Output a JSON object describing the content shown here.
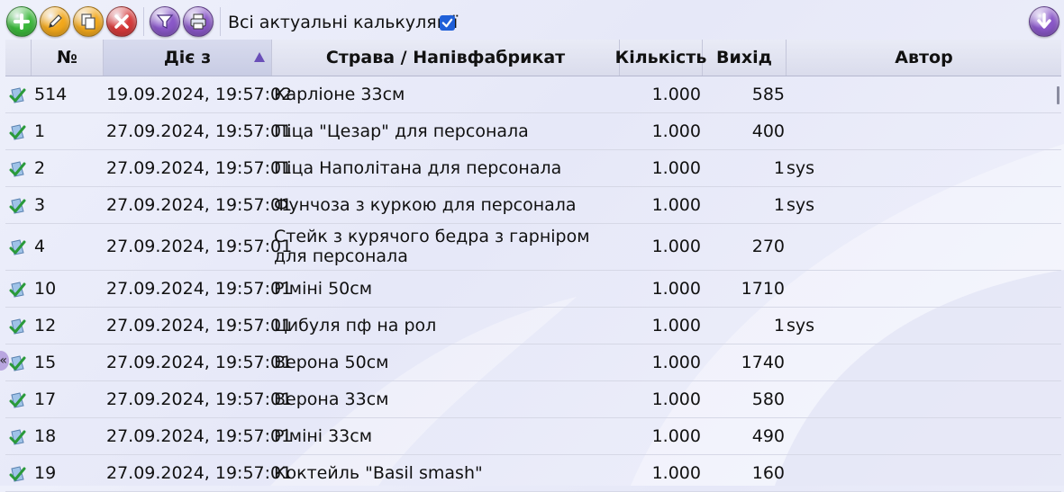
{
  "toolbar": {
    "buttons": [
      {
        "name": "add-button",
        "icon": "plus-icon",
        "color": "#3cb83c"
      },
      {
        "name": "edit-button",
        "icon": "pencil-icon",
        "color": "#f2a81c"
      },
      {
        "name": "copy-button",
        "icon": "copy-icon",
        "color": "#f2a81c"
      },
      {
        "name": "delete-button",
        "icon": "close-icon",
        "color": "#d63a3a"
      },
      {
        "name": "filter-button",
        "icon": "filter-icon",
        "color": "#8a58c8"
      },
      {
        "name": "print-button",
        "icon": "printer-icon",
        "color": "#8a58c8"
      },
      {
        "name": "scroll-down-button",
        "icon": "arrow-down-icon",
        "color": "#8a58c8"
      }
    ],
    "filter_label": "Всі актуальні калькуляції",
    "filter_checked": true
  },
  "table": {
    "columns": [
      "№",
      "Діє з",
      "Страва / Напівфабрикат",
      "Кількість",
      "Вихід",
      "Автор"
    ],
    "sorted_column": "Діє з",
    "sort_direction": "ascending",
    "rows": [
      {
        "no": "514",
        "date": "19.09.2024, 19:57:02",
        "name": "Карліоне 33см",
        "qty": "1.000",
        "out": "585",
        "unit": "",
        "author": ""
      },
      {
        "no": "1",
        "date": "27.09.2024, 19:57:01",
        "name": "Піца \"Цезар\" для персонала",
        "qty": "1.000",
        "out": "400",
        "unit": "",
        "author": ""
      },
      {
        "no": "2",
        "date": "27.09.2024, 19:57:01",
        "name": "Піца Наполітана для персонала",
        "qty": "1.000",
        "out": "1",
        "unit": "sys",
        "author": ""
      },
      {
        "no": "3",
        "date": "27.09.2024, 19:57:01",
        "name": "Фунчоза з куркою для персонала",
        "qty": "1.000",
        "out": "1",
        "unit": "sys",
        "author": ""
      },
      {
        "no": "4",
        "date": "27.09.2024, 19:57:01",
        "name": "Стейк з курячого бедра з гарніром для персонала",
        "qty": "1.000",
        "out": "270",
        "unit": "",
        "author": ""
      },
      {
        "no": "10",
        "date": "27.09.2024, 19:57:01",
        "name": "Ріміні 50см",
        "qty": "1.000",
        "out": "1710",
        "unit": "",
        "author": ""
      },
      {
        "no": "12",
        "date": "27.09.2024, 19:57:01",
        "name": "Цибуля пф на рол",
        "qty": "1.000",
        "out": "1",
        "unit": "sys",
        "author": ""
      },
      {
        "no": "15",
        "date": "27.09.2024, 19:57:01",
        "name": "Верона 50см",
        "qty": "1.000",
        "out": "1740",
        "unit": "",
        "author": ""
      },
      {
        "no": "17",
        "date": "27.09.2024, 19:57:01",
        "name": "Верона 33см",
        "qty": "1.000",
        "out": "580",
        "unit": "",
        "author": ""
      },
      {
        "no": "18",
        "date": "27.09.2024, 19:57:01",
        "name": "Ріміні 33см",
        "qty": "1.000",
        "out": "490",
        "unit": "",
        "author": ""
      },
      {
        "no": "19",
        "date": "27.09.2024, 19:57:01",
        "name": "Коктейль \"Basil smash\"",
        "qty": "1.000",
        "out": "160",
        "unit": "",
        "author": ""
      }
    ]
  },
  "side_handle": "«"
}
